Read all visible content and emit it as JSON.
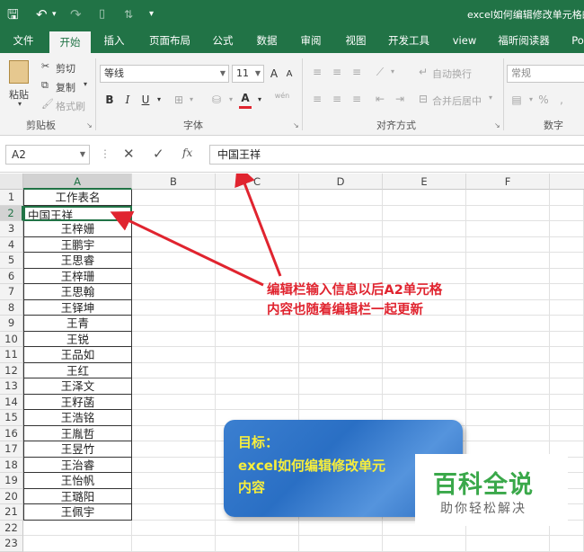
{
  "window": {
    "title": "excel如何编辑修改单元格的"
  },
  "tabs": [
    "文件",
    "开始",
    "插入",
    "页面布局",
    "公式",
    "数据",
    "审阅",
    "视图",
    "开发工具",
    "view",
    "福昕阅读器",
    "Po"
  ],
  "ribbon": {
    "clipboard": {
      "cut": "剪切",
      "copy": "复制",
      "format_painter": "格式刷",
      "paste": "粘贴",
      "group": "剪贴板"
    },
    "font": {
      "name": "等线",
      "size": "11",
      "grow": "A",
      "shrink": "A",
      "bold": "B",
      "italic": "I",
      "underline": "U",
      "font_color_letter": "A",
      "wen": "wén",
      "group": "字体"
    },
    "alignment": {
      "wrap": "自动换行",
      "merge": "合并后居中",
      "group": "对齐方式"
    },
    "number": {
      "format": "常规",
      "percent": "%",
      "comma": ",",
      "group": "数字"
    }
  },
  "formula_bar": {
    "name_box": "A2",
    "fx": "fx",
    "value": "中国王祥"
  },
  "columns": [
    "A",
    "B",
    "C",
    "D",
    "E",
    "F"
  ],
  "rows": [
    "1",
    "2",
    "3",
    "4",
    "5",
    "6",
    "7",
    "8",
    "9",
    "10",
    "11",
    "12",
    "13",
    "14",
    "15",
    "16",
    "17",
    "18",
    "19",
    "20",
    "21",
    "22",
    "23"
  ],
  "column_a": [
    "工作表名",
    "中国王祥",
    "王梓姗",
    "王鹏宇",
    "王思睿",
    "王梓珊",
    "王思翰",
    "王铎坤",
    "王青",
    "王锐",
    "王品如",
    "王红",
    "王泽文",
    "王籽菡",
    "王浩铭",
    "王胤哲",
    "王昱竹",
    "王治睿",
    "王怡帆",
    "王璐阳",
    "王佩宇"
  ],
  "annotations": {
    "red_line1": "编辑栏输入信息以后A2单元格",
    "red_line2": "内容也随着编辑栏一起更新",
    "goal_line1": "目标：",
    "goal_line2": "excel如何编辑修改单元",
    "goal_line3": "内容",
    "accent_red": "#e0242f",
    "accent_yellow": "#f7ee3c"
  },
  "watermark": {
    "main": "百科全说",
    "sub": "助你轻松解决"
  }
}
